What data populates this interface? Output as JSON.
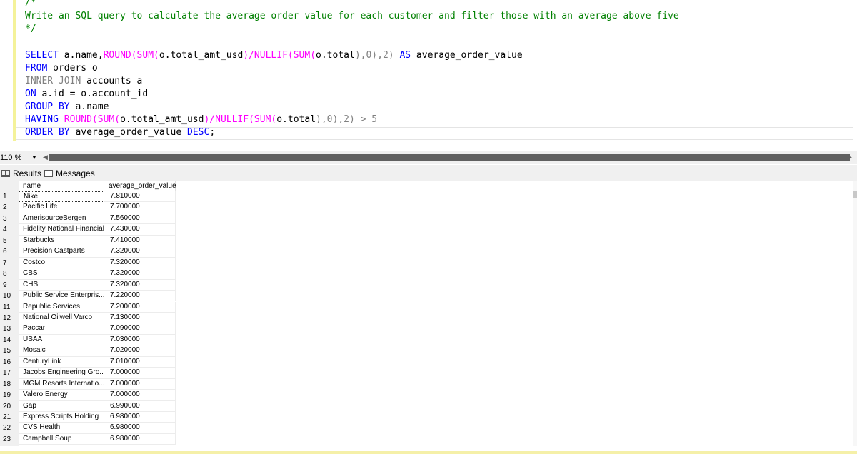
{
  "editor": {
    "comment_open": "/*",
    "comment_text": "Write an SQL query to calculate the average order value for each customer and filter those with an average above five",
    "comment_close": "*/",
    "lines": [
      {
        "kw": "SELECT",
        "a": " a.name,",
        "fn1": "ROUND(SUM(",
        "b": "o.total_amt_usd",
        "fn2": ")/NULLIF(SUM(",
        "c": "o.total",
        "d": "),0),2) ",
        "kw2": "AS",
        "e": " average_order_value"
      },
      {
        "kw": "FROM",
        "rest": " orders o"
      },
      {
        "kw": "INNER JOIN",
        "rest": " accounts a"
      },
      {
        "kw": "ON",
        "rest": " a.id = o.account_id"
      },
      {
        "kw": "GROUP BY",
        "rest": " a.name"
      },
      {
        "kw": "HAVING",
        "fn1": " ROUND(SUM(",
        "b": "o.total_amt_usd",
        "fn2": ")/NULLIF(SUM(",
        "c": "o.total",
        "d": "),0),2) > 5"
      },
      {
        "kw": "ORDER BY",
        "rest": " average_order_value ",
        "kw2": "DESC",
        "end": ";"
      }
    ]
  },
  "zoom": {
    "value": "110 %"
  },
  "tabs": {
    "results": "Results",
    "messages": "Messages"
  },
  "grid": {
    "columns": [
      "name",
      "average_order_value"
    ],
    "rows": [
      {
        "n": "1",
        "name": "Nike",
        "avg": "7.810000"
      },
      {
        "n": "2",
        "name": "Pacific Life",
        "avg": "7.700000"
      },
      {
        "n": "3",
        "name": "AmerisourceBergen",
        "avg": "7.560000"
      },
      {
        "n": "4",
        "name": "Fidelity National Financial",
        "avg": "7.430000"
      },
      {
        "n": "5",
        "name": "Starbucks",
        "avg": "7.410000"
      },
      {
        "n": "6",
        "name": "Precision Castparts",
        "avg": "7.320000"
      },
      {
        "n": "7",
        "name": "Costco",
        "avg": "7.320000"
      },
      {
        "n": "8",
        "name": "CBS",
        "avg": "7.320000"
      },
      {
        "n": "9",
        "name": "CHS",
        "avg": "7.320000"
      },
      {
        "n": "10",
        "name": "Public Service Enterpris...",
        "avg": "7.220000"
      },
      {
        "n": "11",
        "name": "Republic Services",
        "avg": "7.200000"
      },
      {
        "n": "12",
        "name": "National Oilwell Varco",
        "avg": "7.130000"
      },
      {
        "n": "13",
        "name": "Paccar",
        "avg": "7.090000"
      },
      {
        "n": "14",
        "name": "USAA",
        "avg": "7.030000"
      },
      {
        "n": "15",
        "name": "Mosaic",
        "avg": "7.020000"
      },
      {
        "n": "16",
        "name": "CenturyLink",
        "avg": "7.010000"
      },
      {
        "n": "17",
        "name": "Jacobs Engineering Gro...",
        "avg": "7.000000"
      },
      {
        "n": "18",
        "name": "MGM Resorts Internatio...",
        "avg": "7.000000"
      },
      {
        "n": "19",
        "name": "Valero Energy",
        "avg": "7.000000"
      },
      {
        "n": "20",
        "name": "Gap",
        "avg": "6.990000"
      },
      {
        "n": "21",
        "name": "Express Scripts Holding",
        "avg": "6.980000"
      },
      {
        "n": "22",
        "name": "CVS Health",
        "avg": "6.980000"
      },
      {
        "n": "23",
        "name": "Campbell Soup",
        "avg": "6.980000"
      }
    ]
  }
}
